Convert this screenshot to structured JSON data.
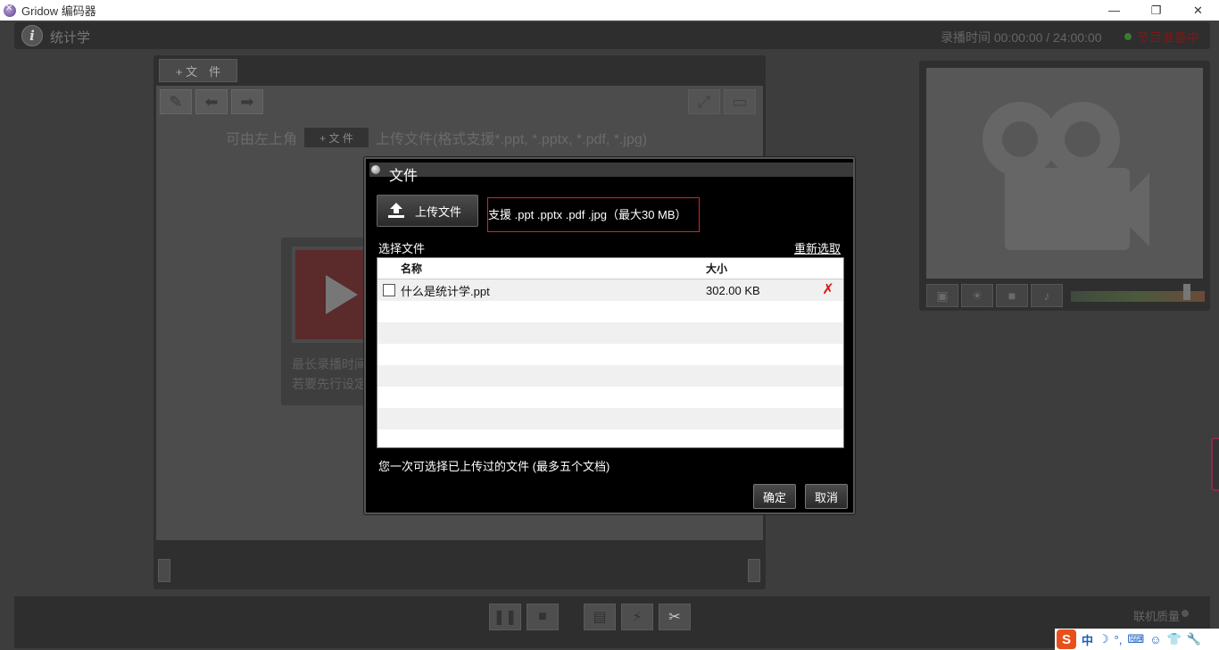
{
  "window": {
    "title": "Gridow 编码器",
    "minimize": "—",
    "restore": "❐",
    "close": "✕"
  },
  "header": {
    "title": "统计学",
    "rec_time": "录播时间 00:00:00  / 24:00:00",
    "status": "节目准备中"
  },
  "doc_panel": {
    "tab_label": "+ 文　件",
    "hint_before": "可由左上角",
    "hint_chip": "+ 文 件",
    "hint_after": "上传文件(格式支援*.ppt, *.pptx, *.pdf, *.jpg)",
    "card_line1": "最长录播时间",
    "card_line2": "若要先行设定"
  },
  "dialog": {
    "title": "文件",
    "upload_label": "上传文件",
    "support_text": "支援 .ppt .pptx .pdf .jpg（最大30 MB）",
    "select_label": "选择文件",
    "reselect_label": "重新选取",
    "columns": {
      "name": "名称",
      "size": "大小"
    },
    "rows": [
      {
        "name": "什么是统计学.ppt",
        "size": "302.00 KB"
      },
      {
        "name": "",
        "size": ""
      },
      {
        "name": "",
        "size": ""
      },
      {
        "name": "",
        "size": ""
      },
      {
        "name": "",
        "size": ""
      },
      {
        "name": "",
        "size": ""
      },
      {
        "name": "",
        "size": ""
      },
      {
        "name": "",
        "size": ""
      }
    ],
    "footnote": "您一次可选择已上传过的文件 (最多五个文档)",
    "ok_label": "确定",
    "cancel_label": "取消"
  },
  "bottom": {
    "net_quality": "联机质量"
  },
  "ime": {
    "logo": "S",
    "lang": "中",
    "items": [
      "☽",
      "°,",
      "⌨",
      "☺",
      "👕",
      "🔧"
    ]
  },
  "colors": {
    "delete": "#e01010",
    "highlight_border": "#dd2222",
    "status_text": "#7a1a1a",
    "ime_logo": "#e8501b"
  }
}
